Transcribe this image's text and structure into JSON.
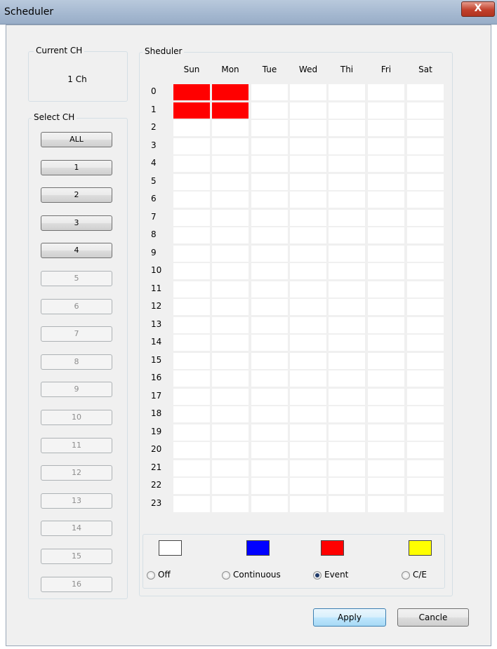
{
  "window": {
    "title": "Scheduler",
    "close_label": "X"
  },
  "current_ch": {
    "label": "Current CH",
    "value": "1 Ch"
  },
  "select_ch": {
    "label": "Select CH",
    "buttons": [
      {
        "label": "ALL",
        "enabled": true
      },
      {
        "label": "1",
        "enabled": true
      },
      {
        "label": "2",
        "enabled": true
      },
      {
        "label": "3",
        "enabled": true
      },
      {
        "label": "4",
        "enabled": true
      },
      {
        "label": "5",
        "enabled": false
      },
      {
        "label": "6",
        "enabled": false
      },
      {
        "label": "7",
        "enabled": false
      },
      {
        "label": "8",
        "enabled": false
      },
      {
        "label": "9",
        "enabled": false
      },
      {
        "label": "10",
        "enabled": false
      },
      {
        "label": "11",
        "enabled": false
      },
      {
        "label": "12",
        "enabled": false
      },
      {
        "label": "13",
        "enabled": false
      },
      {
        "label": "14",
        "enabled": false
      },
      {
        "label": "15",
        "enabled": false
      },
      {
        "label": "16",
        "enabled": false
      }
    ]
  },
  "scheduler": {
    "label": "Sheduler",
    "days": [
      "Sun",
      "Mon",
      "Tue",
      "Wed",
      "Thi",
      "Fri",
      "Sat"
    ],
    "hours": [
      "0",
      "1",
      "2",
      "3",
      "4",
      "5",
      "6",
      "7",
      "8",
      "9",
      "10",
      "11",
      "12",
      "13",
      "14",
      "15",
      "16",
      "17",
      "18",
      "19",
      "20",
      "21",
      "22",
      "23"
    ],
    "event_cells": [
      {
        "day": "Sun",
        "hour": "0"
      },
      {
        "day": "Mon",
        "hour": "0"
      },
      {
        "day": "Sun",
        "hour": "1"
      },
      {
        "day": "Mon",
        "hour": "1"
      }
    ]
  },
  "legend": {
    "items": [
      {
        "label": "Off",
        "color": "#ffffff",
        "checked": false
      },
      {
        "label": "Continuous",
        "color": "#0000ff",
        "checked": false
      },
      {
        "label": "Event",
        "color": "#ff0000",
        "checked": true
      },
      {
        "label": "C/E",
        "color": "#ffff00",
        "checked": false
      }
    ]
  },
  "footer": {
    "apply_label": "Apply",
    "cancel_label": "Cancle"
  }
}
